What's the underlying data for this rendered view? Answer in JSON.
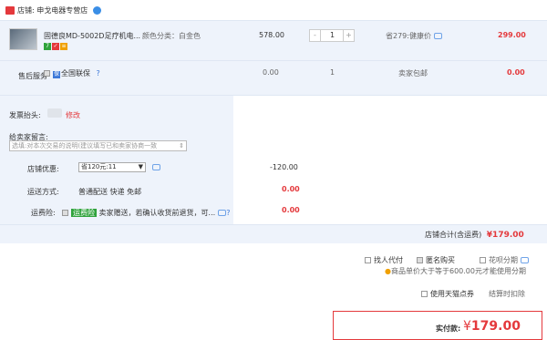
{
  "shop": {
    "label": "店铺:",
    "name": "申戈电器专营店"
  },
  "item": {
    "title": "固德良MD-5002D足疗机电...",
    "variant": "颜色分类：白金色",
    "unit_price": "578.00",
    "quantity": "1",
    "discount": "省279:健康价",
    "subtotal": "299.00",
    "badges": [
      "7",
      "✓",
      "≡"
    ]
  },
  "service": {
    "label": "售后服务",
    "option": "全国联保",
    "price": "0.00",
    "qty": "1",
    "shipping": "卖家包邮",
    "total": "0.00"
  },
  "invoice": {
    "label": "发票抬头:",
    "edit_link": "修改"
  },
  "message": {
    "label": "给卖家留言:",
    "placeholder": "选填:对本次交易的说明(建议填写已和卖家协商一致"
  },
  "coupon": {
    "label": "店铺优惠:",
    "selected": "省120元:11",
    "amount": "-120.00"
  },
  "delivery": {
    "label": "运送方式:",
    "value": "普通配送 快递 免邮",
    "amount": "0.00"
  },
  "insurance": {
    "label": "运费险:",
    "tag": "运费险",
    "desc": "卖家赠送，若确认收货前退货，可...",
    "amount": "0.00"
  },
  "shop_total": {
    "label": "店铺合计(含运费)",
    "amount": "¥179.00"
  },
  "options": {
    "proxy_pay": "找人代付",
    "anonymous": "匿名购买",
    "installment": "花呗分期",
    "installment_note": "商品单价大于等于600.00元才能使用分期",
    "tmall_points": "使用天猫点券",
    "points_note": "结算时扣除"
  },
  "payment": {
    "label": "实付款:",
    "currency": "¥",
    "amount": "179.00"
  },
  "colors": {
    "accent": "#e4393c",
    "row_bg": "#eef3fb",
    "link": "#3c78d8"
  }
}
